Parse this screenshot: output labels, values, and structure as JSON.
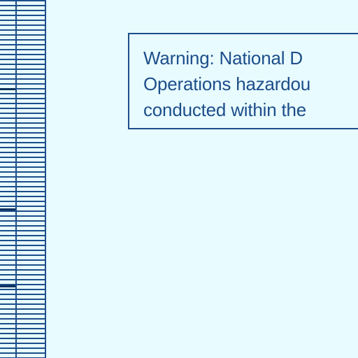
{
  "warning_note": {
    "lines": [
      "Warning: National D",
      "Operations hazardou",
      "conducted within the"
    ]
  },
  "colors": {
    "water": "#e8fbff",
    "ink": "#1d4e8a"
  }
}
